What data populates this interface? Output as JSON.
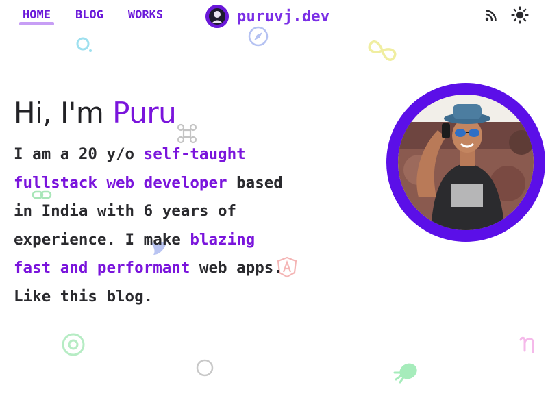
{
  "nav": {
    "items": [
      {
        "label": "HOME",
        "active": true
      },
      {
        "label": "BLOG",
        "active": false
      },
      {
        "label": "WORKS",
        "active": false
      }
    ]
  },
  "brand": {
    "name": "puruvj.dev"
  },
  "header_actions": {
    "icons": [
      "rss-icon",
      "sun-icon"
    ]
  },
  "hero": {
    "greeting": "Hi, I'm ",
    "name": "Puru",
    "intro": {
      "part1": "I am a 20 y/o ",
      "highlight1": "self-taught fullstack web developer",
      "part2": " based in India with 6 years of experience. I make ",
      "highlight2": "blazing fast and performant",
      "part3": " web apps. Like this blog."
    }
  },
  "colors": {
    "accent": "#7a14dc",
    "nav": "#6a18d9",
    "nav_underline": "#c79ef5",
    "avatar_ring": "#5b0fe8",
    "text": "#2a2a2e"
  },
  "decorative_icons": [
    "magnifier-icon",
    "compass-icon",
    "infinity-icon",
    "command-icon",
    "link-icon",
    "bird-icon",
    "angular-icon",
    "at-icon",
    "circle-icon",
    "bug-icon",
    "eta-icon"
  ]
}
